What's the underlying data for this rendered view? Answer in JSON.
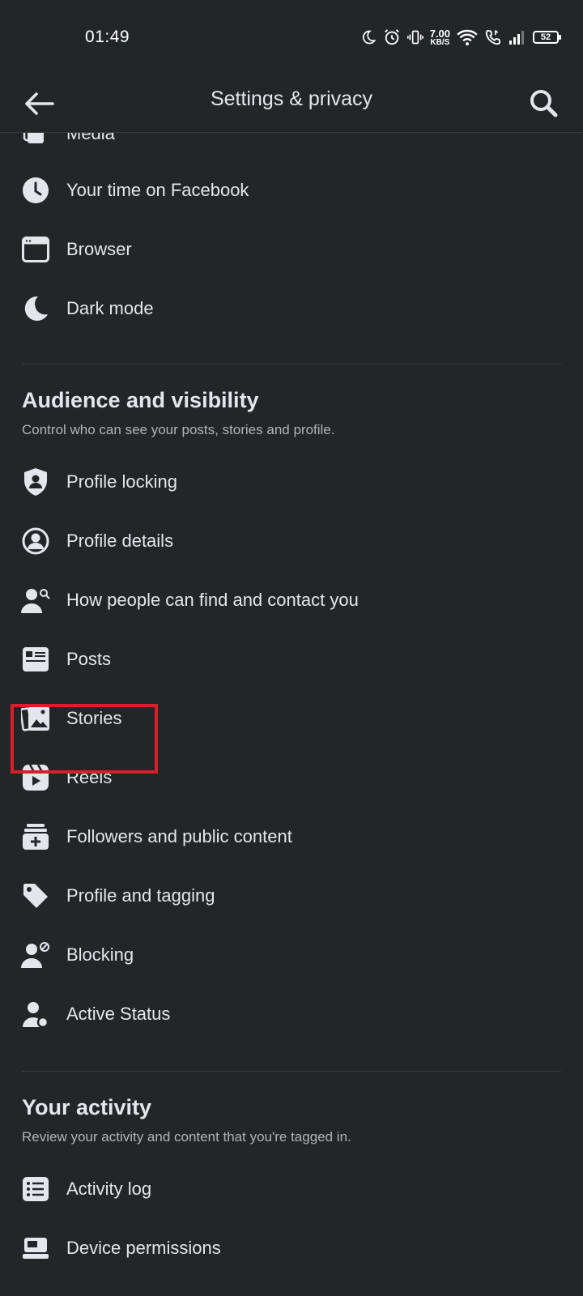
{
  "status_bar": {
    "time": "01:49",
    "net_speed": "7.00",
    "net_unit": "KB/S",
    "battery": "52"
  },
  "header": {
    "title": "Settings & privacy",
    "back_icon": "arrow-left-icon",
    "search_icon": "search-icon"
  },
  "preferences": {
    "items": [
      {
        "label": "Media",
        "icon": "media-icon"
      },
      {
        "label": "Your time on Facebook",
        "icon": "clock-icon"
      },
      {
        "label": "Browser",
        "icon": "browser-icon"
      },
      {
        "label": "Dark mode",
        "icon": "moon-icon"
      }
    ]
  },
  "audience": {
    "title": "Audience and visibility",
    "subtitle": "Control who can see your posts, stories and profile.",
    "items": [
      {
        "label": "Profile locking",
        "icon": "shield-person-icon"
      },
      {
        "label": "Profile details",
        "icon": "person-circle-icon"
      },
      {
        "label": "How people can find and contact you",
        "icon": "person-search-icon"
      },
      {
        "label": "Posts",
        "icon": "posts-icon"
      },
      {
        "label": "Stories",
        "icon": "stories-icon"
      },
      {
        "label": "Reels",
        "icon": "reels-icon"
      },
      {
        "label": "Followers and public content",
        "icon": "followers-icon"
      },
      {
        "label": "Profile and tagging",
        "icon": "tag-icon"
      },
      {
        "label": "Blocking",
        "icon": "person-block-icon"
      },
      {
        "label": "Active Status",
        "icon": "active-status-icon"
      }
    ]
  },
  "activity": {
    "title": "Your activity",
    "subtitle": "Review your activity and content that you're tagged in.",
    "items": [
      {
        "label": "Activity log",
        "icon": "list-icon"
      },
      {
        "label": "Device permissions",
        "icon": "device-icon"
      }
    ]
  },
  "colors": {
    "background": "#242527",
    "text": "#e4e6eb",
    "subtext": "#b0b3b8",
    "icon": "#e4e6eb",
    "highlight": "#d6202a"
  }
}
